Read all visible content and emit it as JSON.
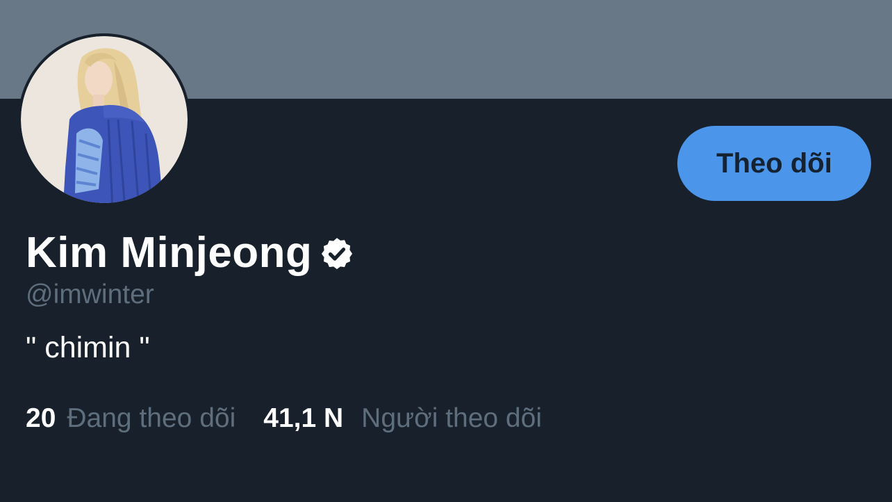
{
  "profile": {
    "display_name": "Kim Minjeong",
    "handle": "@imwinter",
    "bio": "\" chimin \"",
    "verified_icon": "verified-badge-icon"
  },
  "actions": {
    "follow_label": "Theo dõi"
  },
  "stats": {
    "following_count": "20",
    "following_label": "Đang theo dõi",
    "followers_count": "41,1 N",
    "followers_label": "Người theo dõi"
  },
  "colors": {
    "background": "#17202b",
    "banner": "#697886",
    "button": "#4b95ea",
    "button_text": "#142231",
    "muted_text": "#5f6e7d",
    "primary_text": "#ffffff"
  }
}
